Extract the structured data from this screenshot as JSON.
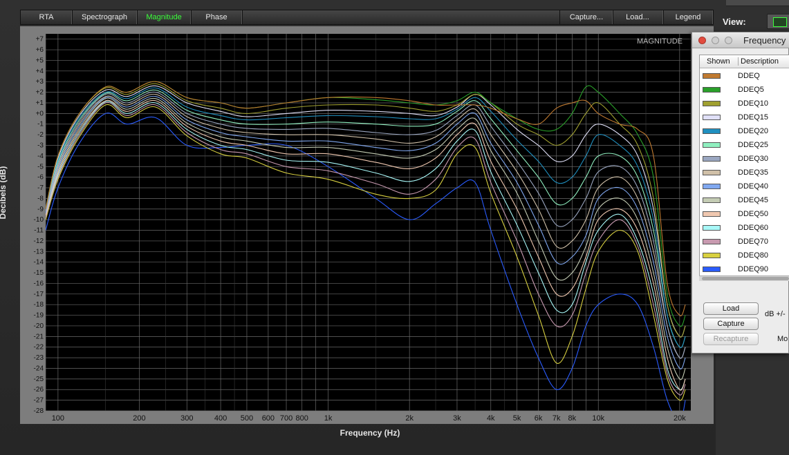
{
  "toolbar": {
    "tabs": [
      {
        "label": "RTA",
        "active": false
      },
      {
        "label": "Spectrograph",
        "active": false
      },
      {
        "label": "Magnitude",
        "active": true
      },
      {
        "label": "Phase",
        "active": false
      }
    ],
    "right_buttons": [
      {
        "label": "Capture..."
      },
      {
        "label": "Load..."
      },
      {
        "label": "Legend"
      }
    ]
  },
  "colors": {
    "active_tab": "#3cff3c",
    "plot_background": "#000000",
    "panel_background": "#7d7d7d",
    "grid": "#6a6a6a"
  },
  "chart_data": {
    "type": "line",
    "title": "MAGNITUDE",
    "xlabel": "Frequency (Hz)",
    "ylabel": "Decibels (dB)",
    "x_scale": "log",
    "xlim": [
      90,
      22000
    ],
    "ylim": [
      -28,
      7.5
    ],
    "grid": true,
    "y_tick_labels": [
      "+7",
      "+6",
      "+5",
      "+4",
      "+3",
      "+2",
      "+1",
      "+0",
      "-1",
      "-2",
      "-3",
      "-4",
      "-5",
      "-6",
      "-7",
      "-8",
      "-9",
      "-10",
      "-11",
      "-12",
      "-13",
      "-14",
      "-15",
      "-16",
      "-17",
      "-18",
      "-19",
      "-20",
      "-21",
      "-22",
      "-23",
      "-24",
      "-25",
      "-26",
      "-27",
      "-28"
    ],
    "x_ticks": [
      {
        "value": 100,
        "label": "100"
      },
      {
        "value": 200,
        "label": "200"
      },
      {
        "value": 300,
        "label": "300"
      },
      {
        "value": 400,
        "label": "400"
      },
      {
        "value": 500,
        "label": "500"
      },
      {
        "value": 600,
        "label": "600"
      },
      {
        "value": 700,
        "label": "700"
      },
      {
        "value": 800,
        "label": "800"
      },
      {
        "value": 1000,
        "label": "1k"
      },
      {
        "value": 2000,
        "label": "2k"
      },
      {
        "value": 3000,
        "label": "3k"
      },
      {
        "value": 4000,
        "label": "4k"
      },
      {
        "value": 5000,
        "label": "5k"
      },
      {
        "value": 6000,
        "label": "6k"
      },
      {
        "value": 7000,
        "label": "7k"
      },
      {
        "value": 8000,
        "label": "8k"
      },
      {
        "value": 10000,
        "label": "10k"
      },
      {
        "value": 20000,
        "label": "20k"
      }
    ],
    "x": [
      90,
      100,
      120,
      150,
      180,
      230,
      300,
      400,
      500,
      700,
      1000,
      1500,
      2000,
      2500,
      3000,
      3500,
      4000,
      5000,
      6000,
      7000,
      8000,
      9000,
      10000,
      12000,
      14000,
      16000,
      18000,
      20000,
      21000
    ],
    "series": [
      {
        "name": "DDEQ",
        "color": "#c07a30",
        "values": [
          -9,
          -4,
          0,
          2.5,
          2.0,
          3.0,
          1.5,
          1.0,
          0.5,
          1.0,
          1.5,
          1.5,
          1.2,
          0.8,
          0.8,
          0.8,
          0.5,
          -0.5,
          -1,
          0.5,
          1,
          1.2,
          0,
          -1,
          -1.5,
          -4,
          -16,
          -19,
          -18
        ]
      },
      {
        "name": "DDEQ5",
        "color": "#2aa02a",
        "values": [
          -9,
          -4,
          0,
          2.5,
          2.0,
          3.0,
          1.5,
          1.0,
          0.5,
          1.0,
          1.5,
          1.3,
          1.0,
          0.8,
          1.2,
          2.0,
          1.0,
          -0.5,
          -1.5,
          -1.5,
          0,
          2.5,
          2,
          0,
          -2,
          -6,
          -17,
          -20,
          -19
        ]
      },
      {
        "name": "DDEQ10",
        "color": "#a0a030",
        "values": [
          -9,
          -4,
          0,
          2.4,
          1.8,
          2.8,
          1.2,
          0.5,
          0,
          0.5,
          0.8,
          0.8,
          0.5,
          0.2,
          0.8,
          1.8,
          1.0,
          -1,
          -2,
          -3,
          -2,
          0,
          1,
          -1,
          -3,
          -8,
          -18,
          -21,
          -20
        ]
      },
      {
        "name": "DDEQ15",
        "color": "#e0e0f8",
        "values": [
          -9,
          -4.2,
          -0.2,
          2.2,
          1.6,
          2.6,
          1.0,
          0.2,
          -0.3,
          0,
          0.3,
          0.2,
          0,
          -0.2,
          0.6,
          1.8,
          0.8,
          -1.5,
          -3,
          -4.5,
          -4,
          -2,
          -1,
          -2,
          -4,
          -9,
          -18,
          -21,
          -20
        ]
      },
      {
        "name": "DDEQ20",
        "color": "#2090c0",
        "values": [
          -9,
          -4.4,
          -0.4,
          2.0,
          1.4,
          2.4,
          0.6,
          -0.2,
          -0.6,
          -0.4,
          -0.2,
          -0.3,
          -0.5,
          -0.5,
          0.4,
          1.5,
          0.2,
          -2.5,
          -4.5,
          -6.5,
          -6,
          -4,
          -2,
          -3,
          -5,
          -10,
          -19,
          -22,
          -21
        ]
      },
      {
        "name": "DDEQ25",
        "color": "#90f0c0",
        "values": [
          -9,
          -4.6,
          -0.6,
          1.9,
          1.2,
          2.2,
          0.3,
          -0.6,
          -1.0,
          -1.0,
          -0.8,
          -1.0,
          -1.2,
          -1.0,
          0.2,
          1.2,
          -0.5,
          -3.5,
          -6,
          -8.5,
          -8,
          -6,
          -4,
          -4,
          -6,
          -11,
          -19,
          -22,
          -21
        ]
      },
      {
        "name": "DDEQ30",
        "color": "#9aa6c0",
        "values": [
          -9.2,
          -4.8,
          -0.8,
          1.8,
          1.0,
          2.0,
          0,
          -1.0,
          -1.4,
          -1.5,
          -1.4,
          -1.8,
          -2.0,
          -1.6,
          -0.2,
          0.8,
          -1.2,
          -4.5,
          -7.5,
          -10.5,
          -10,
          -8,
          -5.5,
          -5,
          -7,
          -12,
          -20,
          -23,
          -22
        ]
      },
      {
        "name": "DDEQ35",
        "color": "#d0c0a8",
        "values": [
          -9.2,
          -5,
          -1,
          1.6,
          0.8,
          1.8,
          -0.3,
          -1.4,
          -1.8,
          -2.0,
          -2.0,
          -2.4,
          -2.8,
          -2.2,
          -0.6,
          0.4,
          -2.0,
          -5.5,
          -9,
          -12.5,
          -12,
          -10,
          -7,
          -6,
          -8,
          -13,
          -20,
          -23,
          -22
        ]
      },
      {
        "name": "DDEQ40",
        "color": "#80a8f0",
        "values": [
          -9.4,
          -5.2,
          -1.2,
          1.5,
          0.6,
          1.6,
          -0.6,
          -1.8,
          -2.2,
          -2.6,
          -2.6,
          -3.2,
          -3.5,
          -2.8,
          -1.0,
          0.0,
          -2.8,
          -6.5,
          -10.5,
          -14,
          -13.5,
          -11.5,
          -8,
          -7,
          -9,
          -14,
          -21,
          -24,
          -23
        ]
      },
      {
        "name": "DDEQ45",
        "color": "#c4ccb4",
        "values": [
          -9.4,
          -5.4,
          -1.4,
          1.4,
          0.4,
          1.4,
          -0.9,
          -2.2,
          -2.6,
          -3.2,
          -3.2,
          -3.8,
          -4.2,
          -3.4,
          -1.5,
          -0.5,
          -3.5,
          -7.5,
          -12,
          -15.5,
          -15,
          -12.5,
          -9,
          -8,
          -10,
          -15,
          -22,
          -25,
          -24
        ]
      },
      {
        "name": "DDEQ50",
        "color": "#f0c8b0",
        "values": [
          -9.6,
          -5.6,
          -1.6,
          1.2,
          0.2,
          1.2,
          -1.2,
          -2.6,
          -3.0,
          -3.8,
          -3.8,
          -4.6,
          -5.2,
          -4.2,
          -2.0,
          -1.0,
          -4.5,
          -9,
          -13.5,
          -17,
          -16.5,
          -13.5,
          -10,
          -9,
          -11,
          -16,
          -23,
          -26,
          -25
        ]
      },
      {
        "name": "DDEQ60",
        "color": "#a8f8f8",
        "values": [
          -9.6,
          -5.8,
          -1.8,
          1.1,
          0,
          1.0,
          -1.5,
          -3.0,
          -3.4,
          -4.4,
          -4.6,
          -5.6,
          -6.4,
          -5.2,
          -2.6,
          -1.6,
          -5.5,
          -10.5,
          -15,
          -18.5,
          -18,
          -14,
          -11,
          -9.5,
          -12,
          -17,
          -24,
          -26,
          -25
        ]
      },
      {
        "name": "DDEQ70",
        "color": "#c89ab0",
        "values": [
          -9.8,
          -6,
          -2,
          1.0,
          -0.2,
          0.8,
          -1.8,
          -3.4,
          -3.8,
          -5.0,
          -5.4,
          -6.6,
          -7.6,
          -6.2,
          -3.2,
          -2.4,
          -6.5,
          -12,
          -17,
          -20,
          -19,
          -15,
          -12,
          -10,
          -12.5,
          -18,
          -24.5,
          -26.5,
          -25.5
        ]
      },
      {
        "name": "DDEQ80",
        "color": "#d8d040",
        "values": [
          -10,
          -6.2,
          -2.2,
          0.8,
          -0.4,
          0.6,
          -2.1,
          -3.8,
          -4.2,
          -5.6,
          -6.2,
          -7.6,
          -8.0,
          -7.2,
          -3.8,
          -3.2,
          -7.5,
          -13.5,
          -19,
          -23.5,
          -21,
          -16.5,
          -13,
          -11,
          -13,
          -19,
          -25,
          -27,
          -26
        ]
      },
      {
        "name": "DDEQ90",
        "color": "#2a5cff",
        "values": [
          -11,
          -7,
          -2.8,
          0,
          -1.0,
          -0.4,
          -3.0,
          -3.2,
          -3.0,
          -3.0,
          -5.0,
          -8.0,
          -10.0,
          -8.5,
          -7.0,
          -6.5,
          -11,
          -18,
          -23,
          -26,
          -24,
          -20,
          -18,
          -17,
          -18,
          -22,
          -27,
          -29,
          -27
        ]
      }
    ]
  },
  "freq_window": {
    "title": "Frequency",
    "col_shown": "Shown",
    "col_description": "Description",
    "load_button": "Load",
    "capture_button": "Capture",
    "recapture_button": "Recapture",
    "db_text": "dB +/-",
    "mo_text": "Mo"
  },
  "view": {
    "label": "View:"
  }
}
